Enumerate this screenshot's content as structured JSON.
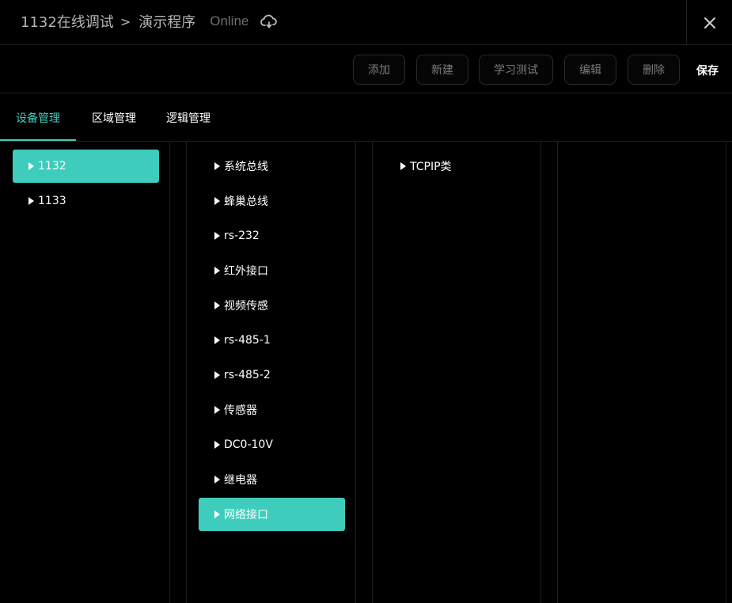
{
  "header": {
    "app_title": "1132在线调试",
    "separator": ">",
    "program": "演示程序",
    "status": "Online"
  },
  "toolbar": {
    "buttons": [
      "添加",
      "新建",
      "学习测试",
      "编辑",
      "删除"
    ],
    "save_label": "保存"
  },
  "tabs": [
    "设备管理",
    "区域管理",
    "逻辑管理"
  ],
  "columns": {
    "devices": [
      "1132",
      "1133"
    ],
    "interfaces": [
      "系统总线",
      "蜂巢总线",
      "rs-232",
      "红外接口",
      "视频传感",
      "rs-485-1",
      "rs-485-2",
      "传感器",
      "DC0-10V",
      "继电器",
      "网络接口"
    ],
    "types": [
      "TCPIP类"
    ]
  },
  "colors": {
    "accent": "#3ecdbd",
    "background": "#000000",
    "border": "#1f1f1f"
  }
}
